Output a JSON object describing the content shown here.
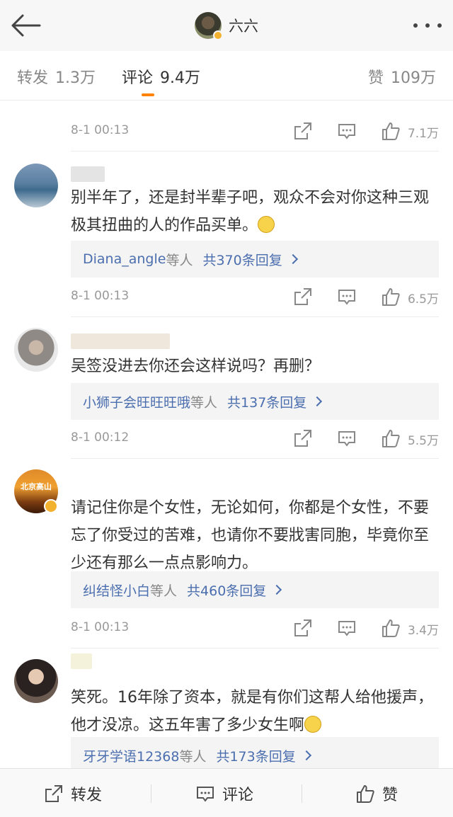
{
  "header": {
    "title": "六六"
  },
  "tabs": [
    {
      "label": "转发",
      "count": "1.3万"
    },
    {
      "label": "评论",
      "count": "9.4万"
    },
    {
      "label": "赞",
      "count": "109万"
    }
  ],
  "colors": {
    "accent": "#ff8200",
    "link": "#4b6eaf",
    "verified": "#f2b230"
  },
  "comments": [
    {
      "time": "8-1 00:13",
      "likes": "7.1万"
    },
    {
      "text": "别半年了，还是封半辈子吧，观众不会对你这种三观极其扭曲的人的作品买单。",
      "emoji": "thinking-emoji",
      "reply_names": "Diana_angle",
      "reply_suffix": "等人",
      "reply_count": "共370条回复",
      "time": "8-1 00:13",
      "likes": "6.5万"
    },
    {
      "text": "吴签没进去你还会这样说吗？再删？",
      "reply_names": "小狮子会旺旺旺哦",
      "reply_suffix": "等人",
      "reply_count": "共137条回复",
      "time": "8-1 00:12",
      "likes": "5.5万"
    },
    {
      "text": "请记住你是个女性，无论如何，你都是个女性，不要忘了你受过的苦难，也请你不要戕害同胞，毕竟你至少还有那么一点点影响力。",
      "avatar_text": "北京高山",
      "reply_names": "纠结怪小白",
      "reply_suffix": "等人",
      "reply_count": "共460条回复",
      "time": "8-1 00:13",
      "likes": "3.4万"
    },
    {
      "text": "笑死。16年除了资本，就是有你们这帮人给他援声，他才没凉。这五年害了多少女生啊",
      "emoji": "smile-emoji",
      "reply_names": "牙牙学语12368",
      "reply_suffix": "等人",
      "reply_count": "共173条回复"
    }
  ],
  "bottom_bar": {
    "repost": "转发",
    "comment": "评论",
    "like": "赞"
  }
}
